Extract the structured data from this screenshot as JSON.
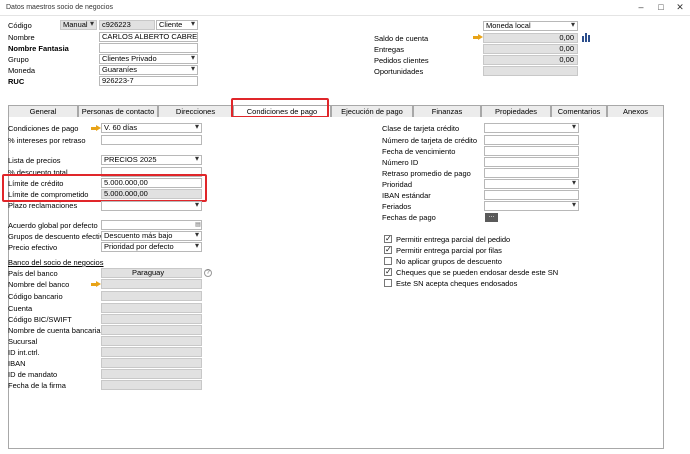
{
  "window": {
    "title": "Datos maestros socio de negocios"
  },
  "header": {
    "codigo_label": "Código",
    "codigo_mode": "Manual",
    "codigo_value": "c926223",
    "tipo_value": "Cliente",
    "nombre_label": "Nombre",
    "nombre_value": "CARLOS ALBERTO CABRERA",
    "nombre_fantasia_label": "Nombre Fantasia",
    "grupo_label": "Grupo",
    "grupo_value": "Clientes Privado",
    "moneda_label": "Moneda",
    "moneda_value": "Guaraníes",
    "ruc_label": "RUC",
    "ruc_value": "926223-7",
    "moneda_local": "Moneda local",
    "saldo_label": "Saldo de cuenta",
    "saldo_value": "0,00",
    "entregas_label": "Entregas",
    "entregas_value": "0,00",
    "pedidos_label": "Pedidos clientes",
    "pedidos_value": "0,00",
    "oportunidades_label": "Oportunidades"
  },
  "tabs": [
    "General",
    "Personas de contacto",
    "Direcciones",
    "Condiciones de pago",
    "Ejecución de pago",
    "Finanzas",
    "Propiedades",
    "Comentarios",
    "Anexos"
  ],
  "left": {
    "condiciones_label": "Condiciones de pago",
    "condiciones_value": "V. 60 días",
    "intereses_label": "% intereses por retraso",
    "lista_label": "Lista de precios",
    "lista_value": "PRECIOS 2025",
    "descuento_total_label": "% descuento total",
    "limite_credito_label": "Límite de crédito",
    "limite_credito_value": "5.000.000,00",
    "limite_comprometido_label": "Límite de comprometido",
    "limite_comprometido_value": "5.000.000,00",
    "plazo_label": "Plazo reclamaciones",
    "acuerdo_label": "Acuerdo global por defecto",
    "grupos_desc_label": "Grupos de descuento efectivo",
    "grupos_desc_value": "Descuento más bajo",
    "precio_efectivo_label": "Precio efectivo",
    "precio_efectivo_value": "Prioridad por defecto",
    "banco_section": "Banco del socio de negocios",
    "pais_label": "País del banco",
    "pais_value": "Paraguay",
    "nombre_banco_label": "Nombre del banco",
    "codigo_bancario_label": "Código bancario",
    "cuenta_label": "Cuenta",
    "bic_label": "Código BIC/SWIFT",
    "nombre_cuenta_label": "Nombre de cuenta bancaria",
    "sucursal_label": "Sucursal",
    "id_ctrl_label": "ID int.ctrl.",
    "iban_label": "IBAN",
    "id_mandato_label": "ID de mandato",
    "fecha_firma_label": "Fecha de la firma"
  },
  "right": {
    "clase_tarjeta_label": "Clase de tarjeta crédito",
    "num_tarjeta_label": "Número de tarjeta de crédito",
    "fecha_venc_label": "Fecha de vencimiento",
    "numero_id_label": "Número ID",
    "retraso_label": "Retraso promedio de pago",
    "prioridad_label": "Prioridad",
    "iban_estandar_label": "IBAN estándar",
    "feriados_label": "Feriados",
    "fechas_pago_label": "Fechas de pago",
    "fechas_pago_button": "...",
    "checks": [
      {
        "label": "Permitir entrega parcial del pedido",
        "checked": true
      },
      {
        "label": "Permitir entrega parcial por filas",
        "checked": true
      },
      {
        "label": "No aplicar grupos de descuento",
        "checked": false
      },
      {
        "label": "Cheques que se pueden endosar desde este SN",
        "checked": true
      },
      {
        "label": "Este SN acepta cheques endosados",
        "checked": false
      }
    ]
  },
  "colors": {
    "highlight": "#e0262a",
    "arrow": "#e8a317"
  }
}
